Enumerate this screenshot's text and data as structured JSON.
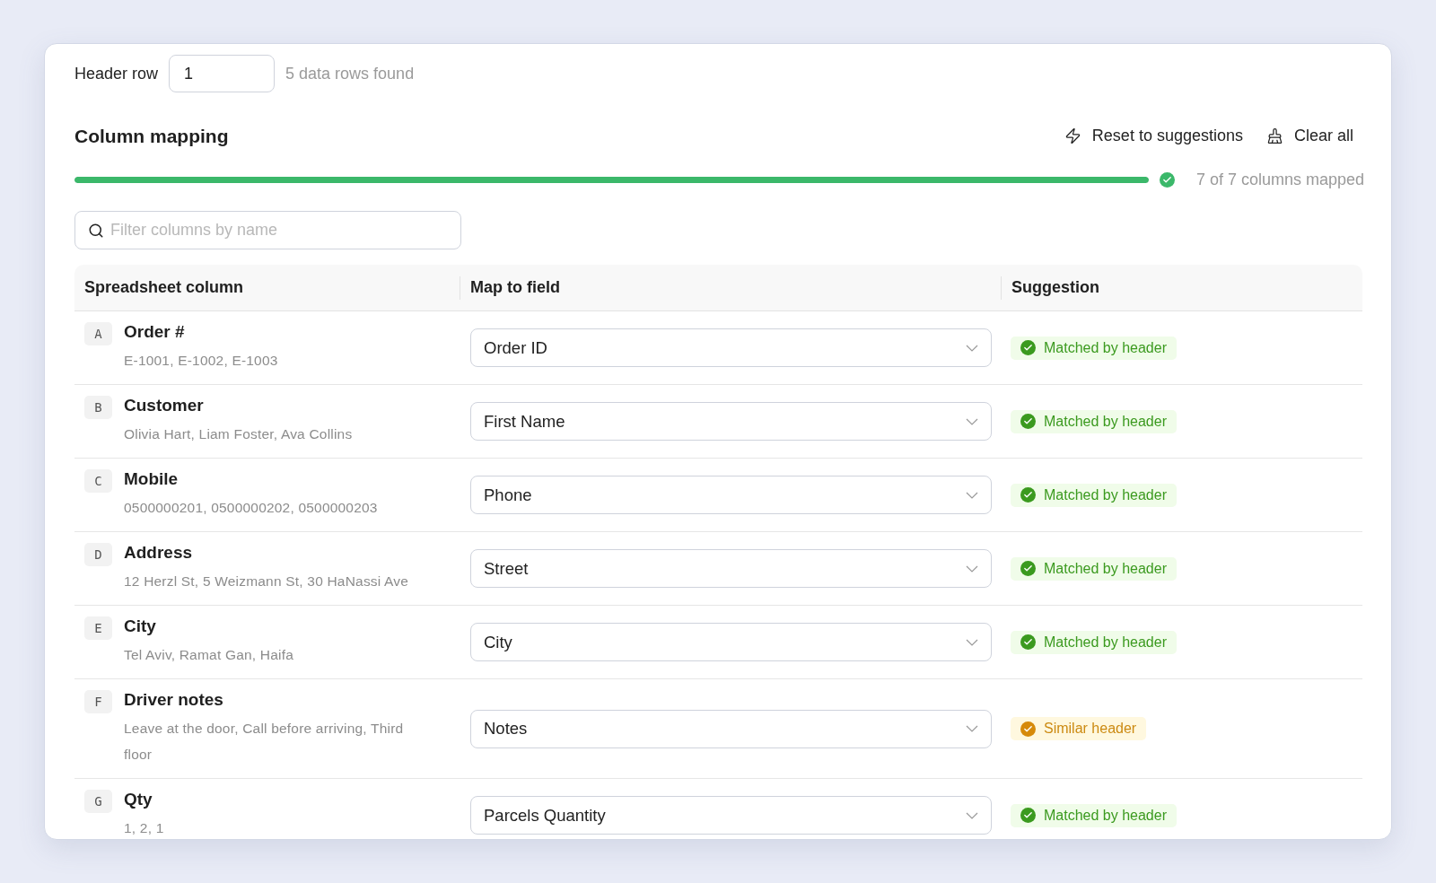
{
  "header_row": {
    "label": "Header row",
    "value": "1",
    "info": "5 data rows found"
  },
  "mapping": {
    "title": "Column mapping",
    "actions": [
      {
        "kind": "reset",
        "label": "Reset to suggestions"
      },
      {
        "kind": "clear",
        "label": "Clear all"
      }
    ],
    "progress": {
      "level": 1,
      "complete": true,
      "label": "7 of 7 columns mapped"
    },
    "filter": {
      "placeholder": "Filter columns by name"
    },
    "table": {
      "columns": [
        "Spreadsheet column",
        "Map to field",
        "Suggestion"
      ],
      "rows": [
        {
          "letter": "A",
          "name": "Order #",
          "sample": "E-1001, E-1002, E-1003",
          "field": "Order ID",
          "suggestion": {
            "kind": "matched",
            "label": "Matched by header"
          }
        },
        {
          "letter": "B",
          "name": "Customer",
          "sample": "Olivia Hart, Liam Foster, Ava Collins",
          "field": "First Name",
          "suggestion": {
            "kind": "matched",
            "label": "Matched by header"
          }
        },
        {
          "letter": "C",
          "name": "Mobile",
          "sample": "0500000201, 0500000202, 0500000203",
          "field": "Phone",
          "suggestion": {
            "kind": "matched",
            "label": "Matched by header"
          }
        },
        {
          "letter": "D",
          "name": "Address",
          "sample": "12 Herzl St, 5 Weizmann St, 30 HaNassi Ave",
          "field": "Street",
          "suggestion": {
            "kind": "matched",
            "label": "Matched by header"
          }
        },
        {
          "letter": "E",
          "name": "City",
          "sample": "Tel Aviv, Ramat Gan, Haifa",
          "field": "City",
          "suggestion": {
            "kind": "matched",
            "label": "Matched by header"
          }
        },
        {
          "letter": "F",
          "name": "Driver notes",
          "sample": "Leave at the door, Call before arriving, Third floor",
          "field": "Notes",
          "suggestion": {
            "kind": "similar",
            "label": "Similar header"
          }
        },
        {
          "letter": "G",
          "name": "Qty",
          "sample": "1, 2, 1",
          "field": "Parcels Quantity",
          "suggestion": {
            "kind": "matched",
            "label": "Matched by header"
          }
        }
      ]
    }
  }
}
